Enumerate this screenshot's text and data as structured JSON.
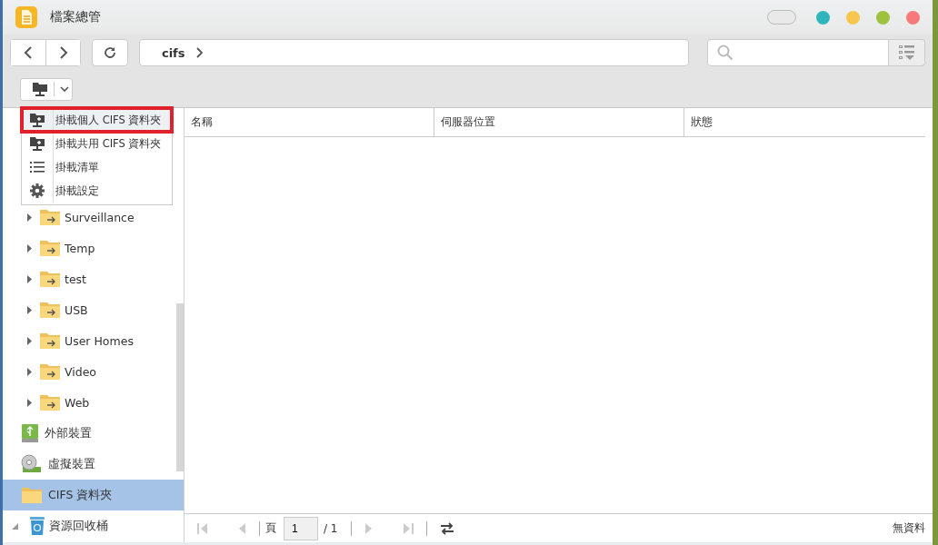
{
  "window": {
    "title": "檔案總管"
  },
  "address": {
    "path": "cifs"
  },
  "menu": {
    "items": [
      {
        "label": "掛載個人 CIFS 資料夾",
        "kind": "mount",
        "selected": true
      },
      {
        "label": "掛載共用 CIFS 資料夾",
        "kind": "mount",
        "selected": false
      },
      {
        "label": "掛載清單",
        "kind": "list",
        "selected": false
      },
      {
        "label": "掛載設定",
        "kind": "settings",
        "selected": false
      }
    ]
  },
  "sidebar": {
    "items": [
      {
        "label": "Surveillance",
        "kind": "share",
        "expanded": false,
        "selected": false
      },
      {
        "label": "Temp",
        "kind": "share",
        "expanded": false,
        "selected": false
      },
      {
        "label": "test",
        "kind": "share",
        "expanded": false,
        "selected": false
      },
      {
        "label": "USB",
        "kind": "share",
        "expanded": false,
        "selected": false
      },
      {
        "label": "User Homes",
        "kind": "share",
        "expanded": false,
        "selected": false
      },
      {
        "label": "Video",
        "kind": "share",
        "expanded": false,
        "selected": false
      },
      {
        "label": "Web",
        "kind": "share",
        "expanded": false,
        "selected": false
      },
      {
        "label": "外部裝置",
        "kind": "usb",
        "selected": false
      },
      {
        "label": "虛擬裝置",
        "kind": "disc",
        "selected": false
      },
      {
        "label": "CIFS 資料夾",
        "kind": "folder",
        "selected": true
      },
      {
        "label": "資源回收桶",
        "kind": "trash",
        "expanded": true,
        "selected": false
      }
    ]
  },
  "table": {
    "columns": [
      "名稱",
      "伺服器位置",
      "狀態"
    ]
  },
  "pager": {
    "page_label": "頁",
    "page": "1",
    "total": "/ 1",
    "status": "無資料"
  }
}
